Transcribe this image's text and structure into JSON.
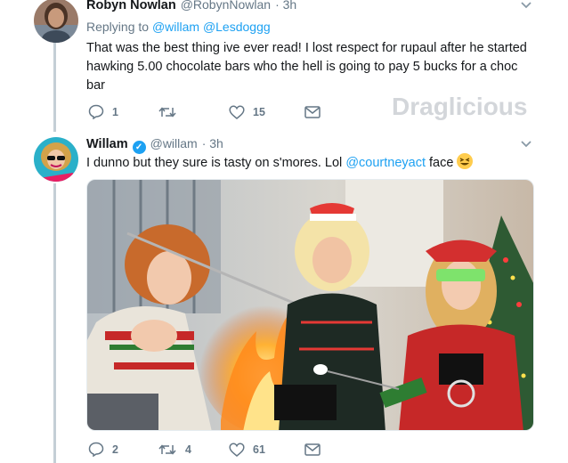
{
  "tweets": [
    {
      "name": "Robyn Nowlan",
      "handle": "@RobynNowlan",
      "time": "· 3h",
      "replying_prefix": "Replying to",
      "replying_mentions": [
        "@willam",
        "@Lesdoggg"
      ],
      "text_lines": [
        "That was the best thing ive ever read!  I lost respect for  rupaul after he started",
        "hawking 5.00 chocolate bars  who the hell  is going to pay 5 bucks for a choc",
        "bar"
      ],
      "replies": "1",
      "retweets": "",
      "likes": "15"
    },
    {
      "name": "Willam",
      "verified": true,
      "handle": "@willam",
      "time": "· 3h",
      "text_before": "I dunno but they sure is tasty on s'mores. Lol ",
      "text_mention": "@courtneyact",
      "text_after": " face",
      "emoji": "grinning-squinting-face",
      "replies": "2",
      "retweets": "4",
      "likes": "61"
    }
  ],
  "watermark": "Draglicious",
  "colors": {
    "link": "#1da1f2",
    "muted": "#657786",
    "thread_line": "#c4cfd6",
    "text": "#14171a"
  },
  "icons": [
    "reply-icon",
    "retweet-icon",
    "like-icon",
    "dm-icon",
    "chevron-down-icon",
    "verified-badge-icon"
  ]
}
